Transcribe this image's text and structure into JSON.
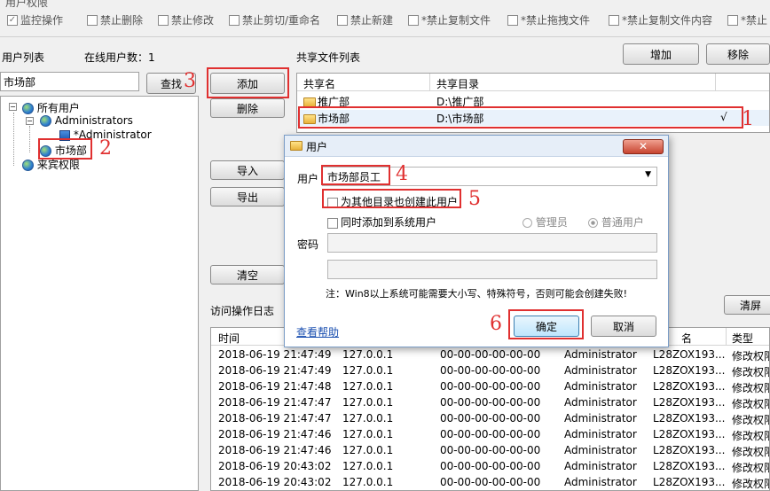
{
  "permissions": {
    "group_title": "用户权限",
    "items": [
      {
        "label": "监控操作",
        "checked": true
      },
      {
        "label": "禁止删除",
        "checked": false
      },
      {
        "label": "禁止修改",
        "checked": false
      },
      {
        "label": "禁止剪切/重命名",
        "checked": false
      },
      {
        "label": "禁止新建",
        "checked": false
      },
      {
        "label": "*禁止复制文件",
        "checked": false
      },
      {
        "label": "*禁止拖拽文件",
        "checked": false
      },
      {
        "label": "*禁止复制文件内容",
        "checked": false
      },
      {
        "label": "*禁止",
        "checked": false
      }
    ]
  },
  "user_panel": {
    "title": "用户列表",
    "online_label": "在线用户数：1",
    "search_value": "市场部",
    "search_button": "查找",
    "tree": {
      "root": "所有用户",
      "admins": "Administrators",
      "admin_user": "*Administrator",
      "market": "市场部",
      "guest": "来宾权限"
    }
  },
  "middle_buttons": {
    "add": "添加",
    "delete": "删除",
    "import": "导入",
    "export": "导出",
    "clear": "清空"
  },
  "share_panel": {
    "title": "共享文件列表",
    "add_button": "增加",
    "remove_button": "移除",
    "columns": [
      "共享名",
      "共享目录"
    ],
    "rows": [
      {
        "name": "推广部",
        "path": "D:\\推广部",
        "mark": ""
      },
      {
        "name": "市场部",
        "path": "D:\\市场部",
        "mark": "√"
      }
    ]
  },
  "log_panel": {
    "title": "访问操作日志",
    "clear_button": "清屏",
    "columns": [
      "时间",
      "名",
      "类型"
    ],
    "rows": [
      {
        "time": "2018-06-19 21:47:49",
        "ip": "127.0.0.1",
        "mac": "00-00-00-00-00-00",
        "user": "Administrator",
        "host": "L28ZOX193...",
        "type": "修改权限"
      },
      {
        "time": "2018-06-19 21:47:49",
        "ip": "127.0.0.1",
        "mac": "00-00-00-00-00-00",
        "user": "Administrator",
        "host": "L28ZOX193...",
        "type": "修改权限"
      },
      {
        "time": "2018-06-19 21:47:48",
        "ip": "127.0.0.1",
        "mac": "00-00-00-00-00-00",
        "user": "Administrator",
        "host": "L28ZOX193...",
        "type": "修改权限"
      },
      {
        "time": "2018-06-19 21:47:47",
        "ip": "127.0.0.1",
        "mac": "00-00-00-00-00-00",
        "user": "Administrator",
        "host": "L28ZOX193...",
        "type": "修改权限"
      },
      {
        "time": "2018-06-19 21:47:47",
        "ip": "127.0.0.1",
        "mac": "00-00-00-00-00-00",
        "user": "Administrator",
        "host": "L28ZOX193...",
        "type": "修改权限"
      },
      {
        "time": "2018-06-19 21:47:46",
        "ip": "127.0.0.1",
        "mac": "00-00-00-00-00-00",
        "user": "Administrator",
        "host": "L28ZOX193...",
        "type": "修改权限"
      },
      {
        "time": "2018-06-19 21:47:46",
        "ip": "127.0.0.1",
        "mac": "00-00-00-00-00-00",
        "user": "Administrator",
        "host": "L28ZOX193...",
        "type": "修改权限"
      },
      {
        "time": "2018-06-19 20:43:02",
        "ip": "127.0.0.1",
        "mac": "00-00-00-00-00-00",
        "user": "Administrator",
        "host": "L28ZOX193...",
        "type": "修改权限"
      },
      {
        "time": "2018-06-19 20:43:02",
        "ip": "127.0.0.1",
        "mac": "00-00-00-00-00-00",
        "user": "Administrator",
        "host": "L28ZOX193...",
        "type": "修改权限"
      }
    ]
  },
  "dialog": {
    "title": "用户",
    "user_label": "用户",
    "user_value": "市场部员工",
    "create_other_label": "为其他目录也创建此用户",
    "add_system_label": "同时添加到系统用户",
    "admin_label": "管理员",
    "normal_label": "普通用户",
    "password_label": "密码",
    "note": "注：Win8以上系统可能需要大小写、特殊符号，否则可能会创建失败!",
    "help_link": "查看帮助",
    "ok_button": "确定",
    "cancel_button": "取消"
  },
  "annotations": [
    "1",
    "2",
    "3",
    "4",
    "5",
    "6"
  ],
  "colors": {
    "accent": "#e03030",
    "selection": "#cce4f7",
    "link": "#1a4fb0"
  }
}
